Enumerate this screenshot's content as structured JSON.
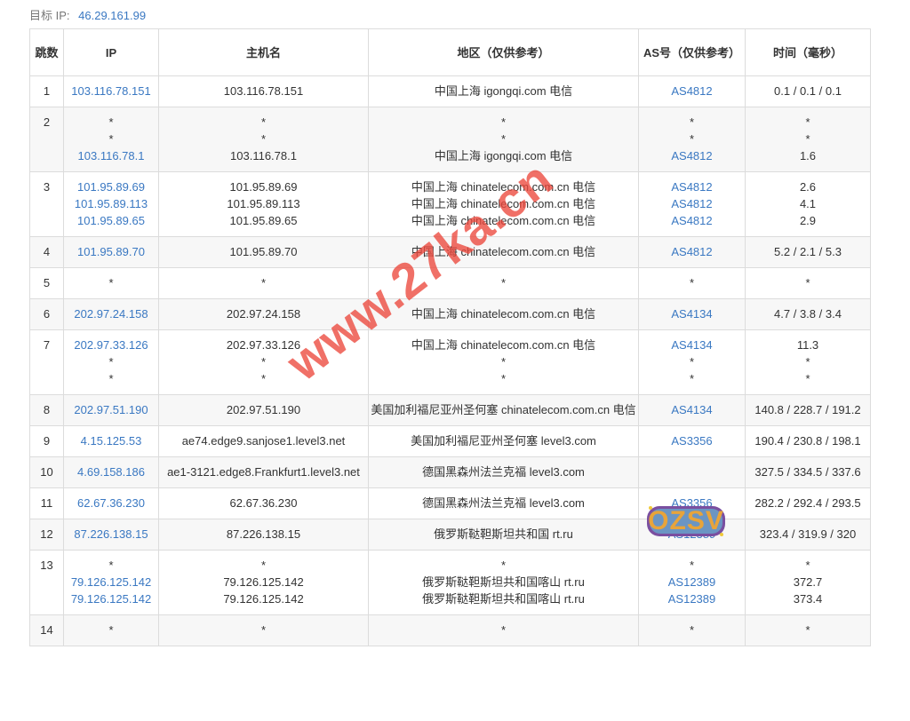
{
  "target": {
    "label": "目标 IP:",
    "ip": "46.29.161.99"
  },
  "headers": {
    "hop": "跳数",
    "ip": "IP",
    "host": "主机名",
    "region": "地区（仅供参考）",
    "as": "AS号（仅供参考）",
    "time": "时间（毫秒）"
  },
  "rows": [
    {
      "hop": "1",
      "ip": [
        "103.116.78.151"
      ],
      "host": [
        "103.116.78.151"
      ],
      "region": [
        "中国上海 igongqi.com 电信"
      ],
      "as": [
        "AS4812"
      ],
      "time": [
        "0.1 / 0.1 / 0.1"
      ]
    },
    {
      "hop": "2",
      "ip": [
        "*",
        "*",
        "103.116.78.1"
      ],
      "host": [
        "*",
        "*",
        "103.116.78.1"
      ],
      "region": [
        "*",
        "*",
        "中国上海 igongqi.com 电信"
      ],
      "as": [
        "*",
        "*",
        "AS4812"
      ],
      "time": [
        "*",
        "*",
        "1.6"
      ]
    },
    {
      "hop": "3",
      "ip": [
        "101.95.89.69",
        "101.95.89.113",
        "101.95.89.65"
      ],
      "host": [
        "101.95.89.69",
        "101.95.89.113",
        "101.95.89.65"
      ],
      "region": [
        "中国上海 chinatelecom.com.cn 电信",
        "中国上海 chinatelecom.com.cn 电信",
        "中国上海 chinatelecom.com.cn 电信"
      ],
      "as": [
        "AS4812",
        "AS4812",
        "AS4812"
      ],
      "time": [
        "2.6",
        "4.1",
        "2.9"
      ]
    },
    {
      "hop": "4",
      "ip": [
        "101.95.89.70"
      ],
      "host": [
        "101.95.89.70"
      ],
      "region": [
        "中国上海 chinatelecom.com.cn 电信"
      ],
      "as": [
        "AS4812"
      ],
      "time": [
        "5.2 / 2.1 / 5.3"
      ]
    },
    {
      "hop": "5",
      "ip": [
        "*"
      ],
      "host": [
        "*"
      ],
      "region": [
        "*"
      ],
      "as": [
        "*"
      ],
      "time": [
        "*"
      ]
    },
    {
      "hop": "6",
      "ip": [
        "202.97.24.158"
      ],
      "host": [
        "202.97.24.158"
      ],
      "region": [
        "中国上海 chinatelecom.com.cn 电信"
      ],
      "as": [
        "AS4134"
      ],
      "time": [
        "4.7 / 3.8 / 3.4"
      ]
    },
    {
      "hop": "7",
      "ip": [
        "202.97.33.126",
        "*",
        "*"
      ],
      "host": [
        "202.97.33.126",
        "*",
        "*"
      ],
      "region": [
        "中国上海 chinatelecom.com.cn 电信",
        "*",
        "*"
      ],
      "as": [
        "AS4134",
        "*",
        "*"
      ],
      "time": [
        "11.3",
        "*",
        "*"
      ]
    },
    {
      "hop": "8",
      "ip": [
        "202.97.51.190"
      ],
      "host": [
        "202.97.51.190"
      ],
      "region": [
        "美国加利福尼亚州圣何塞 chinatelecom.com.cn 电信"
      ],
      "as": [
        "AS4134"
      ],
      "time": [
        "140.8 / 228.7 / 191.2"
      ]
    },
    {
      "hop": "9",
      "ip": [
        "4.15.125.53"
      ],
      "host": [
        "ae74.edge9.sanjose1.level3.net"
      ],
      "region": [
        "美国加利福尼亚州圣何塞 level3.com"
      ],
      "as": [
        "AS3356"
      ],
      "time": [
        "190.4 / 230.8 / 198.1"
      ]
    },
    {
      "hop": "10",
      "ip": [
        "4.69.158.186"
      ],
      "host": [
        "ae1-3121.edge8.Frankfurt1.level3.net"
      ],
      "region": [
        "德国黑森州法兰克福 level3.com"
      ],
      "as": [
        ""
      ],
      "time": [
        "327.5 / 334.5 / 337.6"
      ]
    },
    {
      "hop": "11",
      "ip": [
        "62.67.36.230"
      ],
      "host": [
        "62.67.36.230"
      ],
      "region": [
        "德国黑森州法兰克福 level3.com"
      ],
      "as": [
        "AS3356"
      ],
      "time": [
        "282.2 / 292.4 / 293.5"
      ]
    },
    {
      "hop": "12",
      "ip": [
        "87.226.138.15"
      ],
      "host": [
        "87.226.138.15"
      ],
      "region": [
        "俄罗斯鞑靼斯坦共和国 rt.ru"
      ],
      "as": [
        "AS12389"
      ],
      "time": [
        "323.4 / 319.9 / 320"
      ]
    },
    {
      "hop": "13",
      "ip": [
        "*",
        "79.126.125.142",
        "79.126.125.142"
      ],
      "host": [
        "*",
        "79.126.125.142",
        "79.126.125.142"
      ],
      "region": [
        "*",
        "俄罗斯鞑靼斯坦共和国喀山 rt.ru",
        "俄罗斯鞑靼斯坦共和国喀山 rt.ru"
      ],
      "as": [
        "*",
        "AS12389",
        "AS12389"
      ],
      "time": [
        "*",
        "372.7",
        "373.4"
      ]
    },
    {
      "hop": "14",
      "ip": [
        "*"
      ],
      "host": [
        "*"
      ],
      "region": [
        "*"
      ],
      "as": [
        "*"
      ],
      "time": [
        "*"
      ]
    }
  ],
  "watermark": "www.27ka.cn",
  "sticker": "OZSV",
  "colors": {
    "link": "#3a78c2",
    "watermark": "#ec483c",
    "border": "#dcdcdc",
    "alt_row": "#f7f7f7"
  }
}
